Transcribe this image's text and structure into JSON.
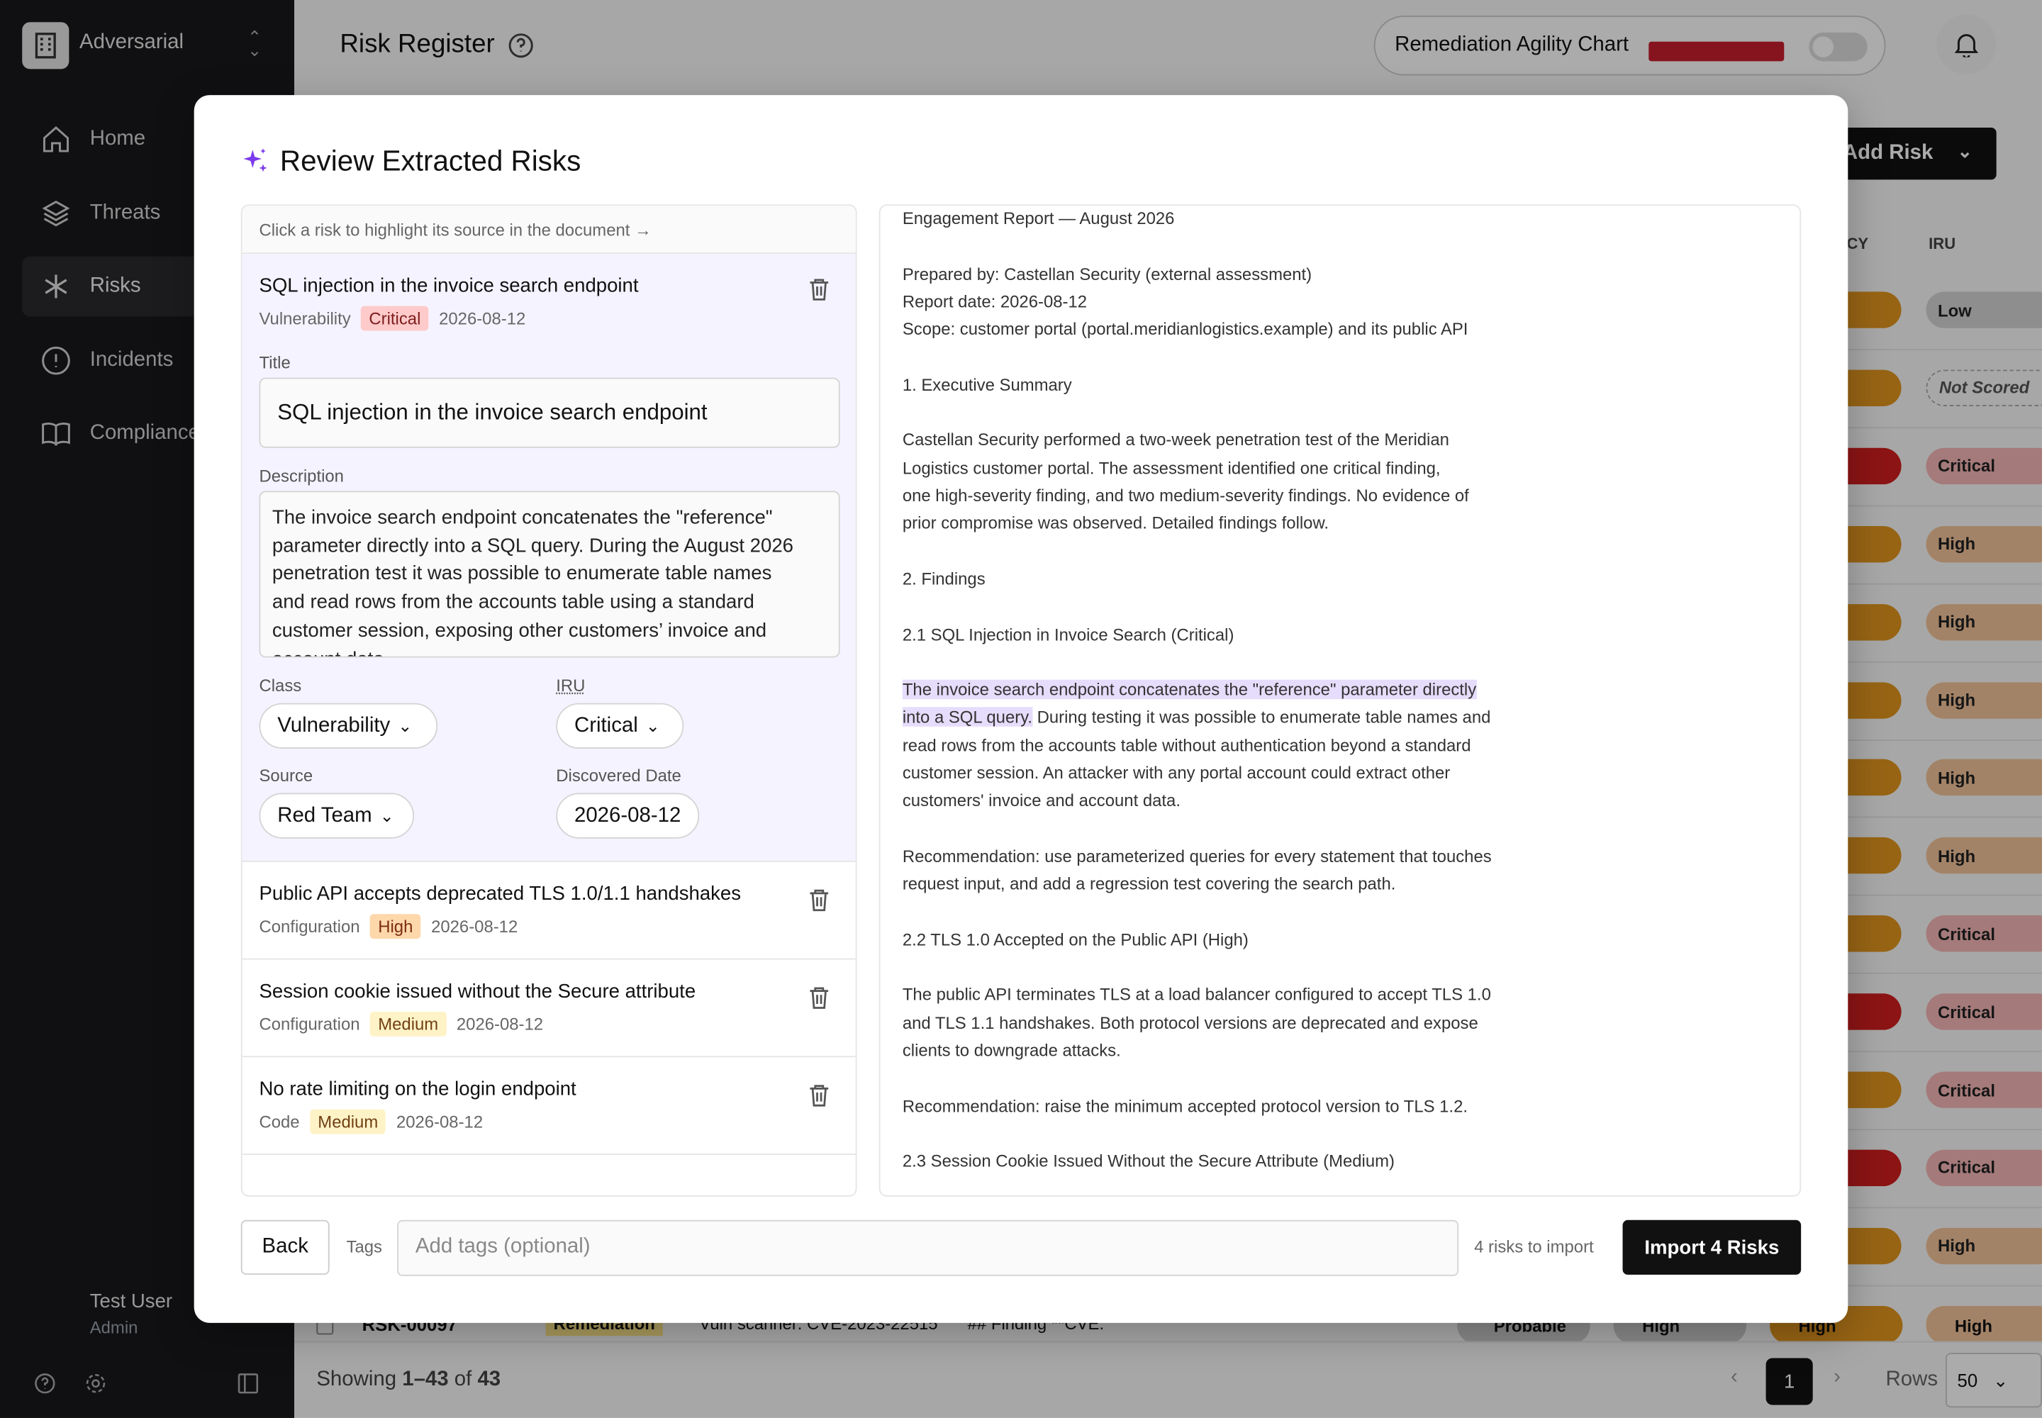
{
  "sidebar": {
    "workspace": "Adversarial",
    "nav": [
      {
        "label": "Home",
        "icon": "home-icon"
      },
      {
        "label": "Threats",
        "icon": "layers-icon"
      },
      {
        "label": "Risks",
        "icon": "asterisk-icon"
      },
      {
        "label": "Incidents",
        "icon": "alert-circle-icon"
      },
      {
        "label": "Compliance",
        "icon": "book-icon"
      }
    ],
    "user": {
      "name": "Test User",
      "role": "Admin"
    }
  },
  "header": {
    "title": "Risk Register",
    "toggle_label": "Remediation Agility Chart",
    "add_button": "Add Risk"
  },
  "table_bg": {
    "col_headers": [
      "CY",
      "IRU"
    ],
    "iru_values": [
      "Low",
      "Not Scored",
      "Critical",
      "High",
      "High",
      "High",
      "High",
      "High",
      "Critical",
      "Critical",
      "Critical",
      "Critical",
      "High",
      "High"
    ],
    "partial_row": {
      "id": "RSK-00097",
      "badge": "Remediation",
      "source": "Vuln scanner: CVE-2023-22515",
      "desc": "## Finding **CVE:",
      "likelihood": "Probable",
      "impact": "High",
      "urgency": "High",
      "iru": "High"
    }
  },
  "footer": {
    "showing_prefix": "Showing",
    "showing_range": "1–43",
    "showing_of": "of",
    "showing_total": "43",
    "page": "1",
    "rows_label": "Rows",
    "rows_value": "50"
  },
  "modal": {
    "title": "Review Extracted Risks",
    "hint": "Click a risk to highlight its source in the document →",
    "selected": {
      "title": "SQL injection in the invoice search endpoint",
      "class": "Vulnerability",
      "severity": "Critical",
      "date": "2026-08-12",
      "form": {
        "title_label": "Title",
        "title_value": "SQL injection in the invoice search endpoint",
        "desc_label": "Description",
        "desc_lines": [
          "The invoice search endpoint concatenates the \"reference\"",
          "parameter directly into a SQL query. During the August 2026",
          "penetration test it was possible to enumerate table names",
          "and read rows from the accounts table using a standard",
          "customer session, exposing other customers’ invoice and",
          "account data."
        ],
        "class_label": "Class",
        "class_value": "Vulnerability",
        "iru_label": "IRU",
        "iru_value": "Critical",
        "source_label": "Source",
        "source_value": "Red Team",
        "date_label": "Discovered Date",
        "date_value": "2026-08-12"
      }
    },
    "risks": [
      {
        "title": "Public API accepts deprecated TLS 1.0/1.1 handshakes",
        "class": "Configuration",
        "severity": "High",
        "date": "2026-08-12"
      },
      {
        "title": "Session cookie issued without the Secure attribute",
        "class": "Configuration",
        "severity": "Medium",
        "date": "2026-08-12"
      },
      {
        "title": "No rate limiting on the login endpoint",
        "class": "Code",
        "severity": "Medium",
        "date": "2026-08-12"
      }
    ],
    "document": {
      "lines_before": [
        "Engagement Report — August 2026",
        "",
        "Prepared by: Castellan Security (external assessment)",
        "Report date: 2026-08-12",
        "Scope: customer portal (portal.meridianlogistics.example) and its public API",
        "",
        "1. Executive Summary",
        "",
        "Castellan Security performed a two-week penetration test of the Meridian",
        "Logistics customer portal. The assessment identified one critical finding,",
        "one high-severity finding, and two medium-severity findings. No evidence of",
        "prior compromise was observed. Detailed findings follow.",
        "",
        "2. Findings",
        "",
        "2.1 SQL Injection in Invoice Search (Critical)",
        ""
      ],
      "highlight_line1": "The invoice search endpoint concatenates the \"reference\" parameter directly",
      "highlight_line2": "into a SQL query.",
      "after_highlight": " During testing it was possible to enumerate table names and",
      "lines_after": [
        "read rows from the accounts table without authentication beyond a standard",
        "customer session. An attacker with any portal account could extract other",
        "customers' invoice and account data.",
        "",
        "Recommendation: use parameterized queries for every statement that touches",
        "request input, and add a regression test covering the search path.",
        "",
        "2.2 TLS 1.0 Accepted on the Public API (High)",
        "",
        "The public API terminates TLS at a load balancer configured to accept TLS 1.0",
        "and TLS 1.1 handshakes. Both protocol versions are deprecated and expose",
        "clients to downgrade attacks.",
        "",
        "Recommendation: raise the minimum accepted protocol version to TLS 1.2.",
        "",
        "2.3 Session Cookie Issued Without the Secure Attribute (Medium)"
      ]
    },
    "back_label": "Back",
    "tags_label": "Tags",
    "tags_placeholder": "Add tags (optional)",
    "count_text": "4 risks to import",
    "import_label": "Import 4 Risks"
  },
  "colors": {
    "critical": "#fecaca",
    "high": "#fed7aa",
    "medium": "#fef3c7",
    "accent": "#7c3aed",
    "highlight": "#e6dcfb"
  }
}
